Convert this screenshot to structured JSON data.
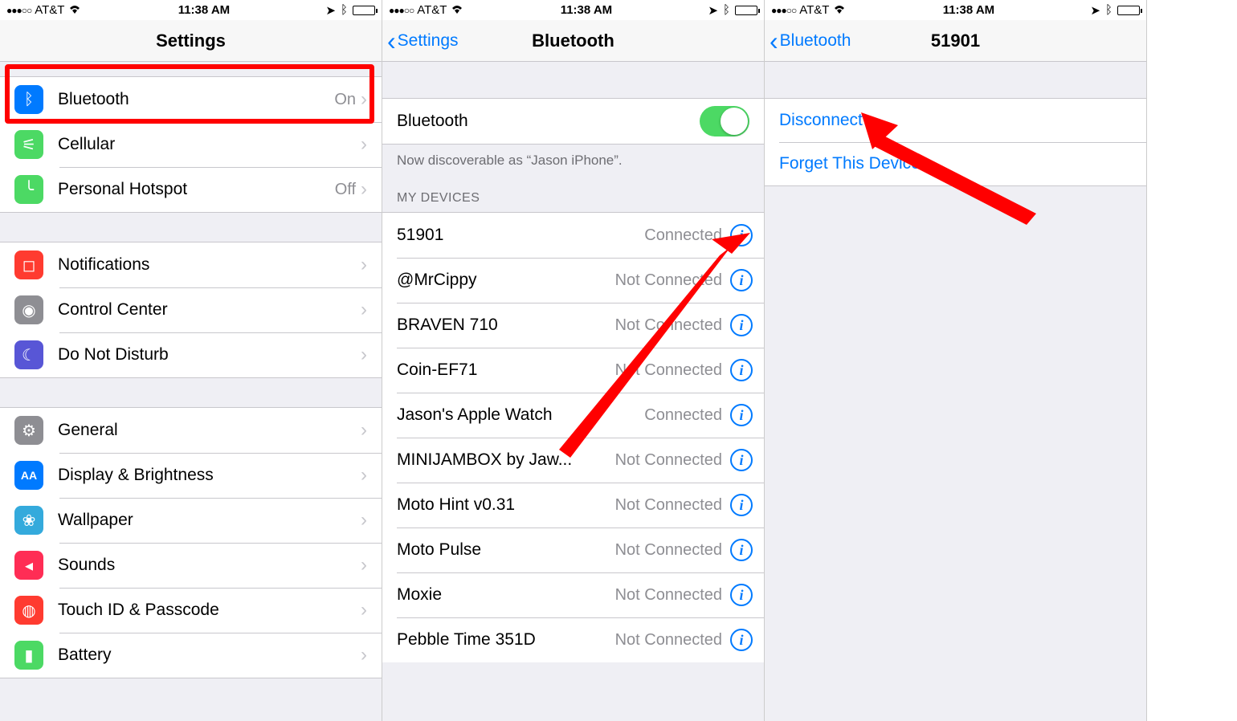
{
  "status": {
    "carrier": "AT&T",
    "time": "11:38 AM",
    "signal": "●●●○○"
  },
  "p1": {
    "title": "Settings",
    "g1": [
      {
        "icon": "bluetooth",
        "color": "c-blue",
        "label": "Bluetooth",
        "value": "On"
      },
      {
        "icon": "antenna",
        "color": "c-green",
        "label": "Cellular",
        "value": ""
      },
      {
        "icon": "link",
        "color": "c-green",
        "label": "Personal Hotspot",
        "value": "Off"
      }
    ],
    "g2": [
      {
        "icon": "notif",
        "color": "c-red",
        "label": "Notifications"
      },
      {
        "icon": "control",
        "color": "c-grey2",
        "label": "Control Center"
      },
      {
        "icon": "moon",
        "color": "c-purple",
        "label": "Do Not Disturb"
      }
    ],
    "g3": [
      {
        "icon": "gear",
        "color": "c-grey2",
        "label": "General"
      },
      {
        "icon": "AA",
        "color": "c-blue",
        "label": "Display & Brightness"
      },
      {
        "icon": "flower",
        "color": "c-teal",
        "label": "Wallpaper"
      },
      {
        "icon": "sound",
        "color": "c-pink",
        "label": "Sounds"
      },
      {
        "icon": "finger",
        "color": "c-red",
        "label": "Touch ID & Passcode"
      },
      {
        "icon": "battery",
        "color": "c-lgreen",
        "label": "Battery"
      }
    ]
  },
  "p2": {
    "back": "Settings",
    "title": "Bluetooth",
    "toggle_label": "Bluetooth",
    "discover": "Now discoverable as “Jason iPhone”.",
    "header": "MY DEVICES",
    "devices": [
      {
        "name": "51901",
        "status": "Connected"
      },
      {
        "name": "@MrCippy",
        "status": "Not Connected"
      },
      {
        "name": "BRAVEN 710",
        "status": "Not Connected"
      },
      {
        "name": "Coin-EF71",
        "status": "Not Connected"
      },
      {
        "name": "Jason's Apple Watch",
        "status": "Connected"
      },
      {
        "name": "MINIJAMBOX by Jaw...",
        "status": "Not Connected"
      },
      {
        "name": "Moto Hint v0.31",
        "status": "Not Connected"
      },
      {
        "name": "Moto Pulse",
        "status": "Not Connected"
      },
      {
        "name": "Moxie",
        "status": "Not Connected"
      },
      {
        "name": "Pebble Time 351D",
        "status": "Not Connected"
      }
    ]
  },
  "p3": {
    "back": "Bluetooth",
    "title": "51901",
    "actions": [
      "Disconnect",
      "Forget This Device"
    ]
  }
}
